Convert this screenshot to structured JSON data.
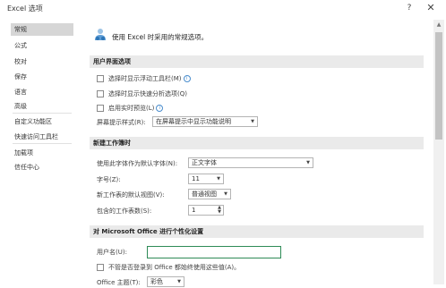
{
  "window": {
    "title": "Excel 选项",
    "help": "?",
    "close": "✕"
  },
  "sidebar": {
    "items": [
      {
        "label": "常规"
      },
      {
        "label": "公式"
      },
      {
        "label": "校对"
      },
      {
        "label": "保存"
      },
      {
        "label": "语言"
      },
      {
        "label": "高级"
      },
      {
        "label": "自定义功能区"
      },
      {
        "label": "快速访问工具栏"
      },
      {
        "label": "加载项"
      },
      {
        "label": "信任中心"
      }
    ],
    "active_index": 0
  },
  "main": {
    "header": "使用 Excel 时采用的常规选项。",
    "ui_section": {
      "title": "用户界面选项",
      "options": [
        {
          "label": "选择时显示浮动工具栏(M)",
          "checked": false,
          "info": true
        },
        {
          "label": "选择时显示快速分析选项(Q)",
          "checked": false,
          "info": false
        },
        {
          "label": "启用实时预览(L)",
          "checked": false,
          "info": true
        }
      ],
      "screentip_label": "屏幕提示样式(R):",
      "screentip_value": "在屏幕提示中显示功能说明"
    },
    "workbook_section": {
      "title": "新建工作簿时",
      "font_label": "使用此字体作为默认字体(N):",
      "font_value": "正文字体",
      "size_label": "字号(Z):",
      "size_value": "11",
      "view_label": "新工作表的默认视图(V):",
      "view_value": "普通视图",
      "sheets_label": "包含的工作表数(S):",
      "sheets_value": "1"
    },
    "personalize_section": {
      "title": "对 Microsoft Office 进行个性化设置",
      "username_label": "用户名(U):",
      "username_value": "",
      "always_use_label": "不管是否登录到 Office 都始终使用这些值(A)。",
      "always_use_checked": false,
      "theme_label": "Office 主题(T):",
      "theme_value": "彩色"
    }
  }
}
